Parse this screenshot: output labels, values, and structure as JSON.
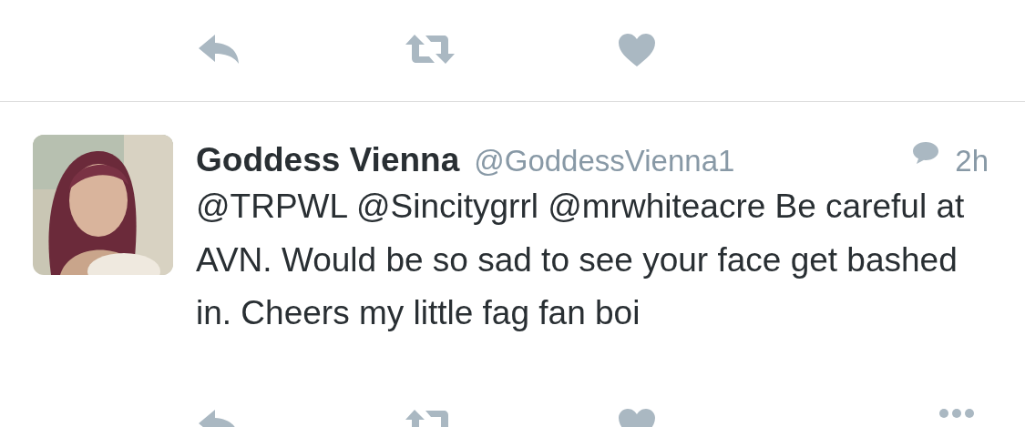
{
  "previous_tweet": {
    "actions": [
      {
        "kind": "reply"
      },
      {
        "kind": "retweet"
      },
      {
        "kind": "like"
      }
    ]
  },
  "tweet": {
    "name": "Goddess Vienna",
    "handle": "@GoddessVienna1",
    "time": "2h",
    "text": "@TRPWL @Sincitygrrl @mrwhiteacre Be careful at AVN. Would be so sad to see your face get bashed in. Cheers my little fag fan boi",
    "actions": [
      {
        "kind": "reply"
      },
      {
        "kind": "retweet"
      },
      {
        "kind": "like"
      },
      {
        "kind": "more"
      }
    ]
  }
}
